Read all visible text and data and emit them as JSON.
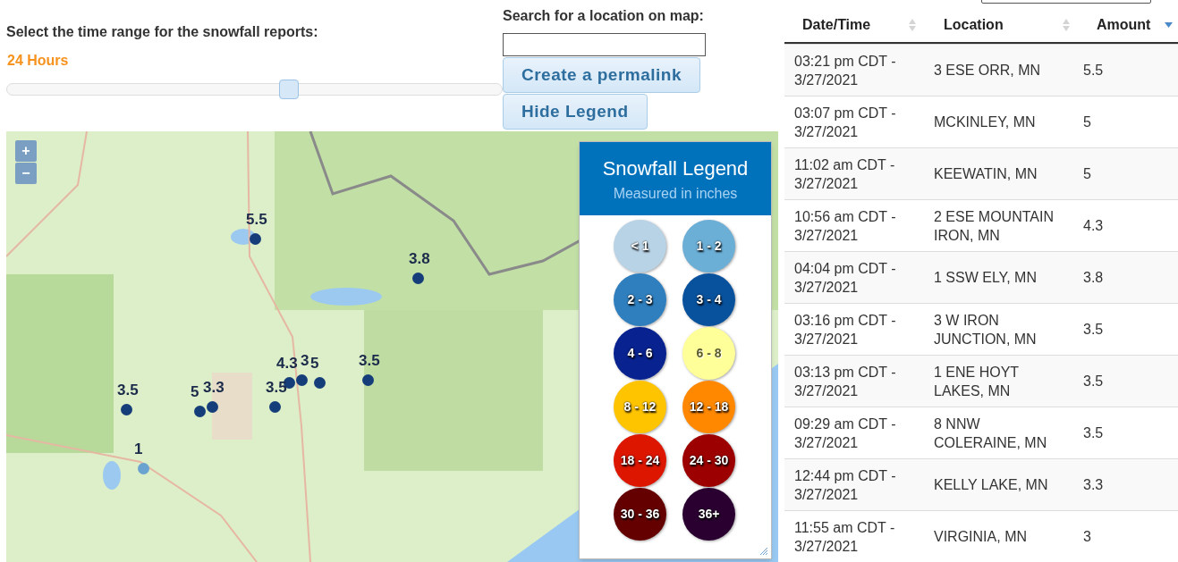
{
  "time_range": {
    "label": "Select the time range for the snowfall reports:",
    "value": "24 Hours",
    "level": 0.57
  },
  "search": {
    "label": "Search for a location on map:"
  },
  "buttons": [
    "Create a permalink",
    "Hide Legend"
  ],
  "map": {
    "zoom_controls": [
      "+",
      "−"
    ],
    "markers": [
      {
        "label": "5.5",
        "color": "#153d7a"
      },
      {
        "label": "3.8",
        "color": "#153d7a"
      },
      {
        "label": "4.3",
        "color": "#153d7a"
      },
      {
        "label": "3",
        "color": "#153d7a"
      },
      {
        "label": "5",
        "color": "#153d7a"
      },
      {
        "label": "3.5",
        "color": "#153d7a"
      },
      {
        "label": "3.5",
        "color": "#153d7a"
      },
      {
        "label": "5",
        "color": "#153d7a"
      },
      {
        "label": "3.3",
        "color": "#153d7a"
      },
      {
        "label": "3.5",
        "color": "#153d7a"
      },
      {
        "label": "1",
        "color": "#6aa3cf"
      }
    ]
  },
  "legend": {
    "title": "Snowfall Legend",
    "subtitle": "Measured in inches",
    "items": [
      {
        "label": "< 1",
        "color": "#b9d3e6"
      },
      {
        "label": "1 - 2",
        "color": "#6baed6"
      },
      {
        "label": "2 - 3",
        "color": "#2f7fbf"
      },
      {
        "label": "3 - 4",
        "color": "#08519c"
      },
      {
        "label": "4 - 6",
        "color": "#08228f"
      },
      {
        "label": "6 - 8",
        "color": "#ffff99"
      },
      {
        "label": "8 - 12",
        "color": "#ffc400"
      },
      {
        "label": "12 - 18",
        "color": "#ff8800"
      },
      {
        "label": "18 - 24",
        "color": "#dd1600"
      },
      {
        "label": "24 - 30",
        "color": "#9c0000"
      },
      {
        "label": "30 - 36",
        "color": "#650000"
      },
      {
        "label": "36+",
        "color": "#2a0030"
      }
    ]
  },
  "table": {
    "columns": [
      {
        "label": "Date/Time",
        "sorted": false
      },
      {
        "label": "Location",
        "sorted": false
      },
      {
        "label": "Amount",
        "sorted": true
      }
    ],
    "rows": [
      [
        "03:21 pm CDT - 3/27/2021",
        "3 ESE ORR, MN",
        "5.5"
      ],
      [
        "03:07 pm CDT - 3/27/2021",
        "MCKINLEY, MN",
        "5"
      ],
      [
        "11:02 am CDT - 3/27/2021",
        "KEEWATIN, MN",
        "5"
      ],
      [
        "10:56 am CDT - 3/27/2021",
        "2 ESE MOUNTAIN IRON, MN",
        "4.3"
      ],
      [
        "04:04 pm CDT - 3/27/2021",
        "1 SSW ELY, MN",
        "3.8"
      ],
      [
        "03:16 pm CDT - 3/27/2021",
        "3 W IRON JUNCTION, MN",
        "3.5"
      ],
      [
        "03:13 pm CDT - 3/27/2021",
        "1 ENE HOYT LAKES, MN",
        "3.5"
      ],
      [
        "09:29 am CDT - 3/27/2021",
        "8 NNW COLERAINE, MN",
        "3.5"
      ],
      [
        "12:44 pm CDT - 3/27/2021",
        "KELLY LAKE, MN",
        "3.3"
      ],
      [
        "11:55 am CDT - 3/27/2021",
        "VIRGINIA, MN",
        "3"
      ]
    ]
  }
}
